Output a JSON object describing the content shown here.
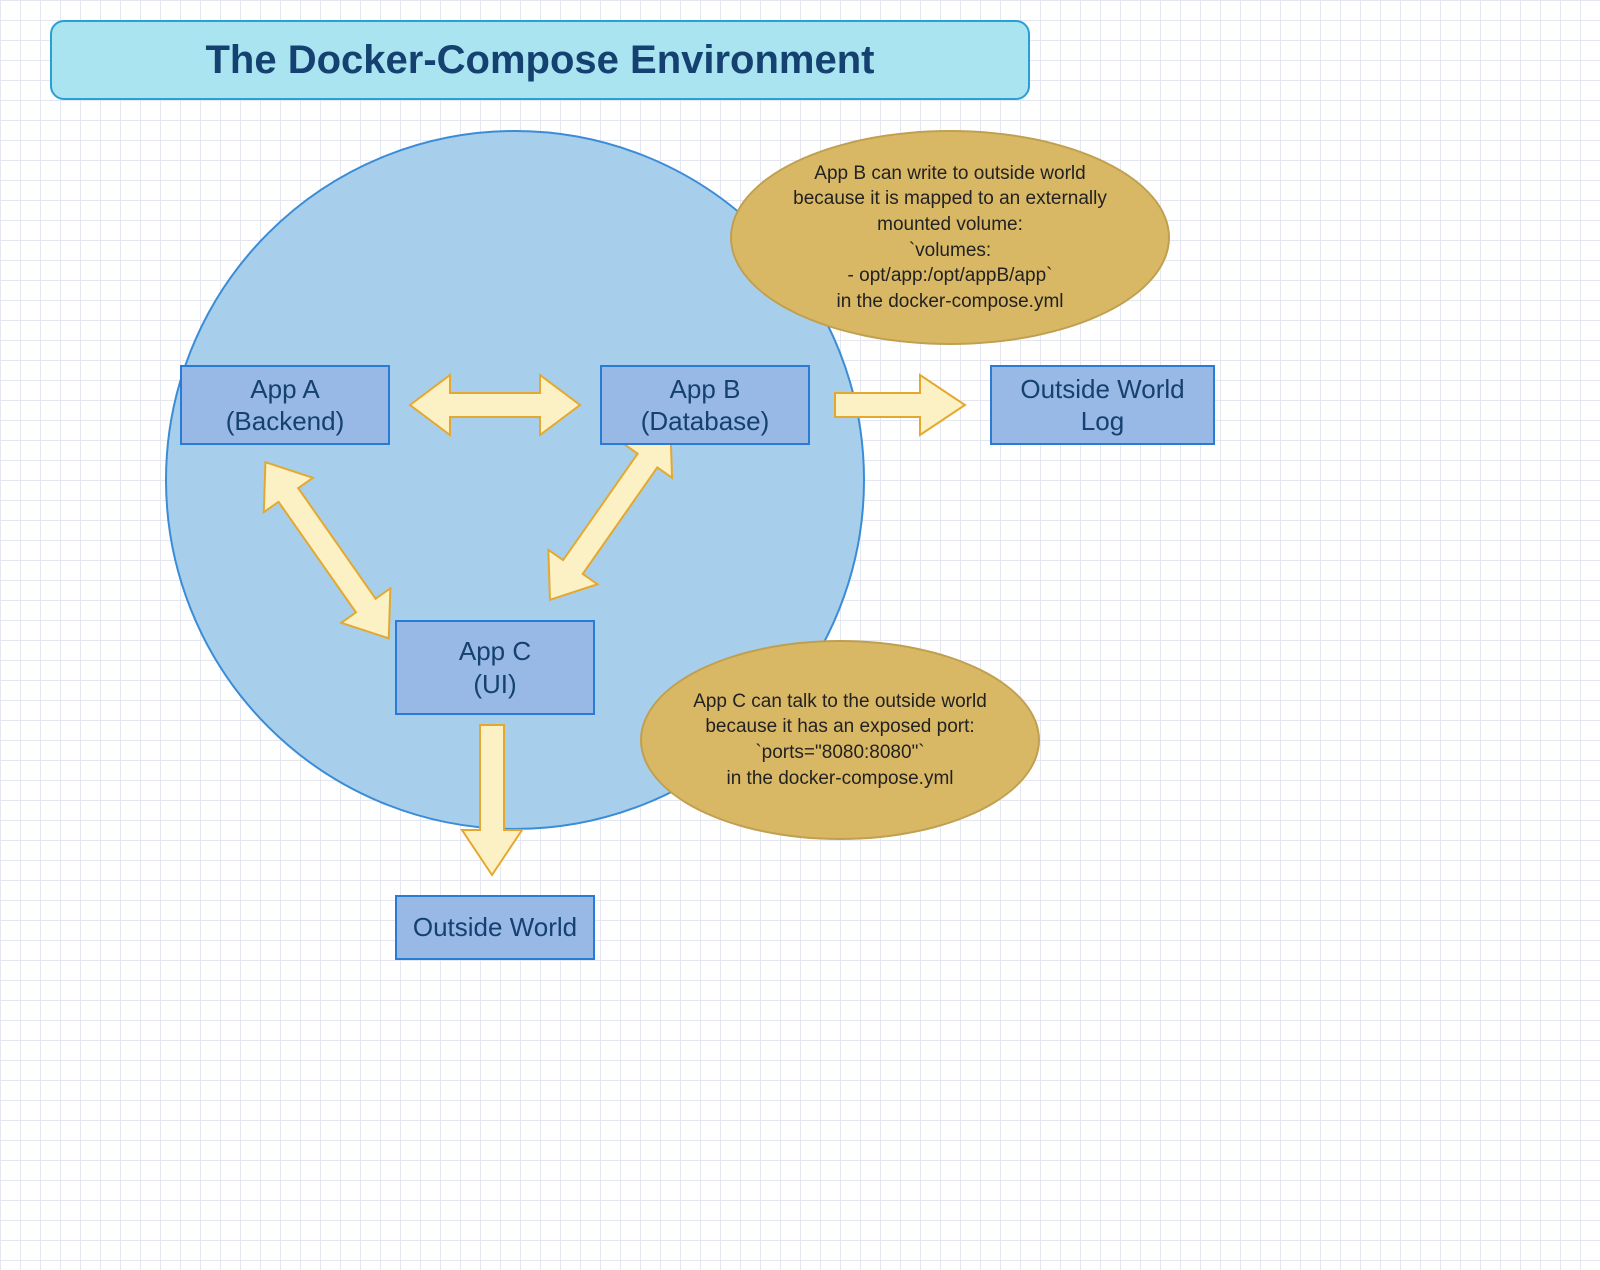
{
  "title": "The Docker-Compose Environment",
  "nodes": {
    "app_a": {
      "line1": "App A",
      "line2": "(Backend)"
    },
    "app_b": {
      "line1": "App B",
      "line2": "(Database)"
    },
    "app_c": {
      "line1": "App C",
      "line2": "(UI)"
    },
    "outside_world": {
      "line1": "Outside World"
    },
    "outside_log": {
      "line1": "Outside World",
      "line2": "Log"
    }
  },
  "callouts": {
    "app_b_note": "App B can write to outside world because it is mapped to an externally mounted volume:\n`volumes:\n- opt/app:/opt/appB/app`\nin the docker-compose.yml",
    "app_c_note": "App C can talk to the outside world because it has an exposed port:\n`ports=\"8080:8080\"`\nin the docker-compose.yml"
  },
  "colors": {
    "title_bg": "#a9e4f0",
    "title_border": "#2a9fd6",
    "title_text": "#14416f",
    "circle_bg": "#a7cfec",
    "circle_border": "#3b8cd6",
    "node_bg": "#98b8e6",
    "node_border": "#2a7bd6",
    "callout_bg": "#d9b865",
    "callout_border": "#c0a050",
    "arrow_fill": "#fcf1c5",
    "arrow_stroke": "#e5a82f"
  }
}
